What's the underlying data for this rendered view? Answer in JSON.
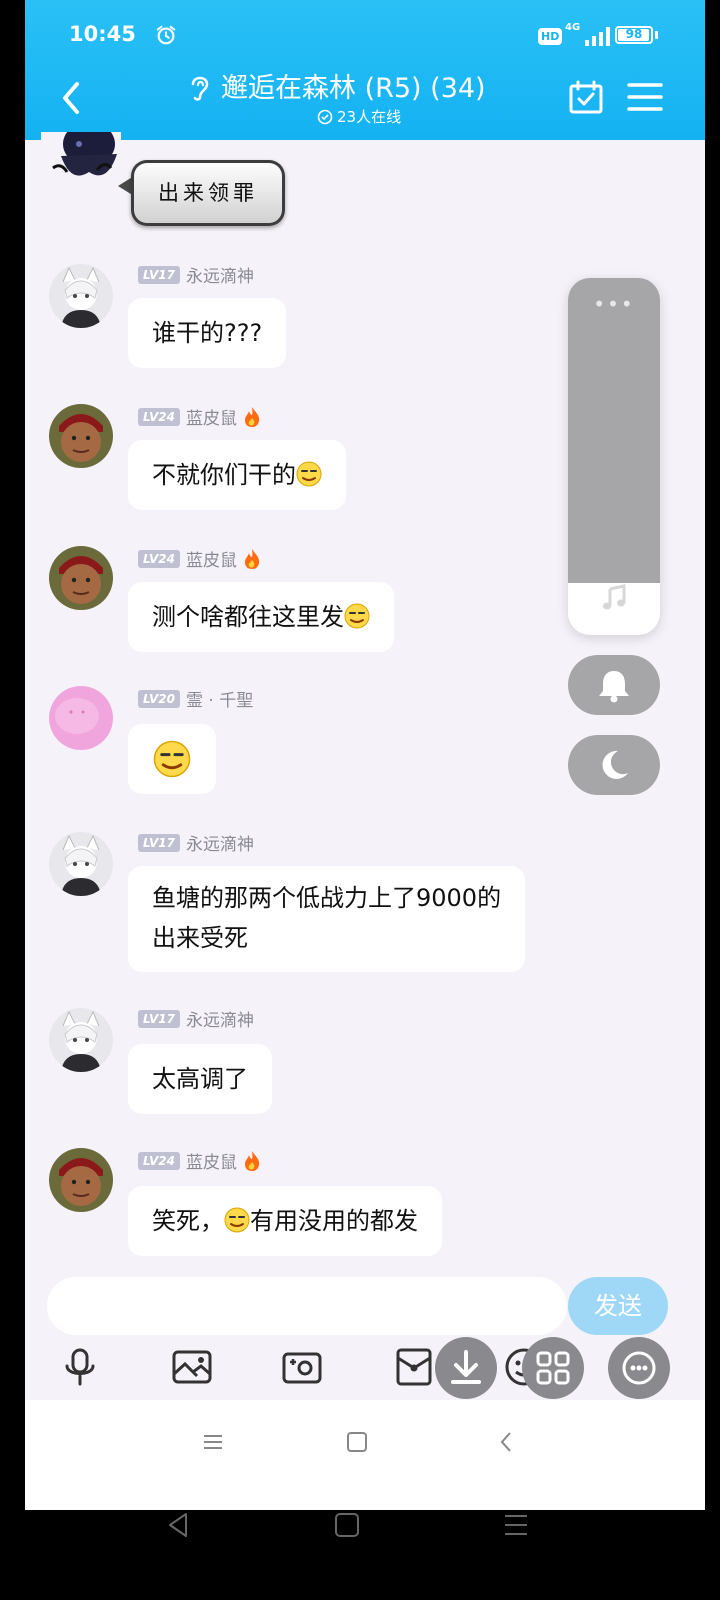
{
  "status_bar": {
    "time": "10:45",
    "hd": "HD",
    "network": "4G",
    "battery": "98",
    "battery_level": 0.98
  },
  "header": {
    "title": "邂逅在森林 (R5) (34)",
    "online": "23人在线"
  },
  "first_message": {
    "text": "出来领罪"
  },
  "messages": [
    {
      "level": "LV17",
      "name": "永远滴神",
      "text": "谁干的???"
    },
    {
      "level": "LV24",
      "name": "蓝皮鼠",
      "text": "不就你们干的"
    },
    {
      "level": "LV24",
      "name": "蓝皮鼠",
      "text": "测个啥都往这里发"
    },
    {
      "level": "LV20",
      "name": "霊 · 千聖",
      "text": ""
    },
    {
      "level": "LV17",
      "name": "永远滴神",
      "text_line1": "鱼塘的那两个低战力上了9000的",
      "text_line2": "出来受死"
    },
    {
      "level": "LV17",
      "name": "永远滴神",
      "text": "太高调了"
    },
    {
      "level": "LV24",
      "name": "蓝皮鼠",
      "text_before": "笑死，",
      "text_after": "有用没用的都发"
    }
  ],
  "float_panel": {
    "dots": "•••"
  },
  "input": {
    "send_label": "发送"
  },
  "colors": {
    "header": "#14b2f2",
    "send": "#9fd8f7",
    "background": "#f5f3f9"
  }
}
